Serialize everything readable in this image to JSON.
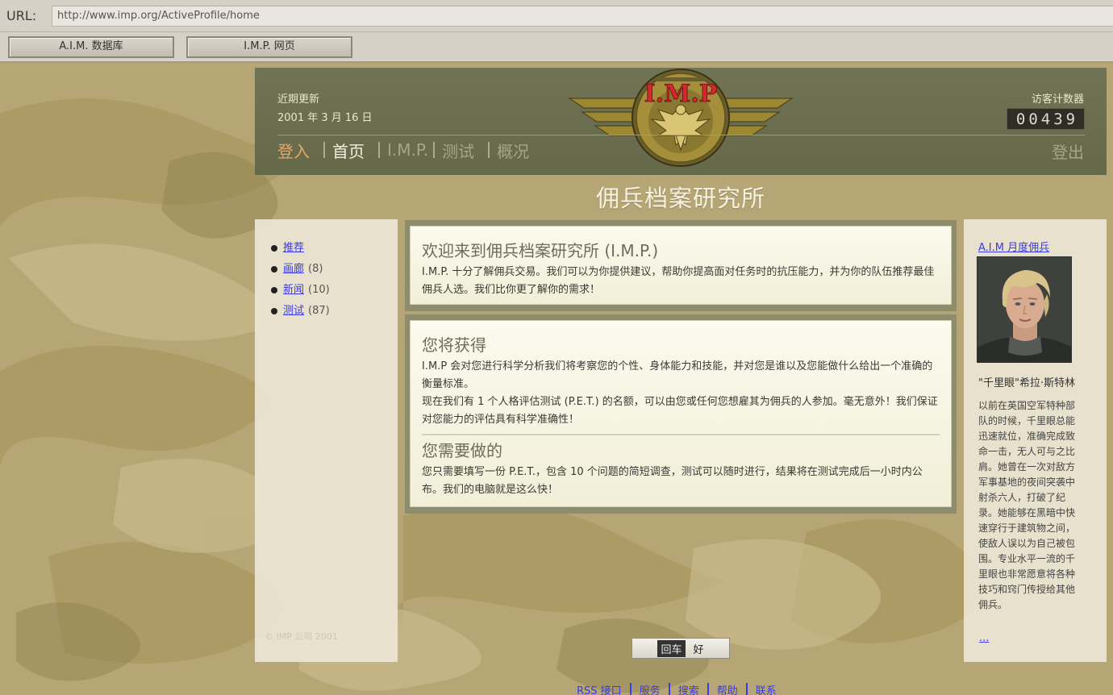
{
  "browser": {
    "url_label": "URL:",
    "url": "http://www.imp.org/ActiveProfile/home",
    "bookmarks": [
      "A.I.M. 数据库",
      "I.M.P. 网页"
    ]
  },
  "header": {
    "recent_label": "近期更新",
    "recent_date": "2001 年 3 月 16 日",
    "counter_label": "访客计数器",
    "counter_value": "00439",
    "logo_text": "I.M.P",
    "nav": {
      "login": "登入",
      "home": "首页",
      "imp": "I.M.P.",
      "test": "测试",
      "overview": "概况",
      "logout": "登出"
    }
  },
  "site_title": "佣兵档案研究所",
  "sidebar": {
    "items": [
      {
        "label": "推荐",
        "count": ""
      },
      {
        "label": "画廊",
        "count": "(8)"
      },
      {
        "label": "新闻",
        "count": "(10)"
      },
      {
        "label": "测试",
        "count": "(87)"
      }
    ],
    "copyright": "© IMP 公司 2001"
  },
  "welcome": {
    "title": "欢迎来到佣兵档案研究所 (I.M.P.)",
    "text": "I.M.P. 十分了解佣兵交易。我们可以为你提供建议，帮助你提高面对任务时的抗压能力，并为你的队伍推荐最佳佣兵人选。我们比你更了解你的需求！"
  },
  "benefits": {
    "title": "您将获得",
    "text1": "I.M.P 会对您进行科学分析我们将考察您的个性、身体能力和技能，并对您是谁以及您能做什么给出一个准确的衡量标准。",
    "text2": "现在我们有 1 个人格评估测试 (P.E.T.) 的名额，可以由您或任何您想雇其为佣兵的人参加。毫无意外！我们保证对您能力的评估具有科学准确性！",
    "todo_title": "您需要做的",
    "todo_text": "您只需要填写一份 P.E.T.，包含 10 个问题的简短调查，测试可以随时进行，结果将在测试完成后一小时内公布。我们的电脑就是这么快！"
  },
  "merc_of_month": {
    "link": "A.I.M 月度佣兵",
    "name": "\"千里眼\"希拉·斯特林",
    "bio": "以前在英国空军特种部队的时候，千里眼总能迅速就位，准确完成致命一击，无人可与之比肩。她曾在一次对敌方军事基地的夜间突袭中射杀六人，打破了纪录。她能够在黑暗中快速穿行于建筑物之间，使敌人误以为自己被包围。专业水平一流的千里眼也非常愿意将各种技巧和窍门传授给其他佣兵。",
    "more": "..."
  },
  "enter_button": {
    "key": "回车",
    "label": "好"
  },
  "footer": {
    "links": [
      "RSS 接口",
      "服务",
      "搜索",
      "帮助",
      "联系"
    ]
  },
  "colors": {
    "header_bg": "#6a6e4f",
    "nav_active": "#e7a765",
    "link": "#3a3ae6",
    "camo_base": "#b7a675"
  }
}
